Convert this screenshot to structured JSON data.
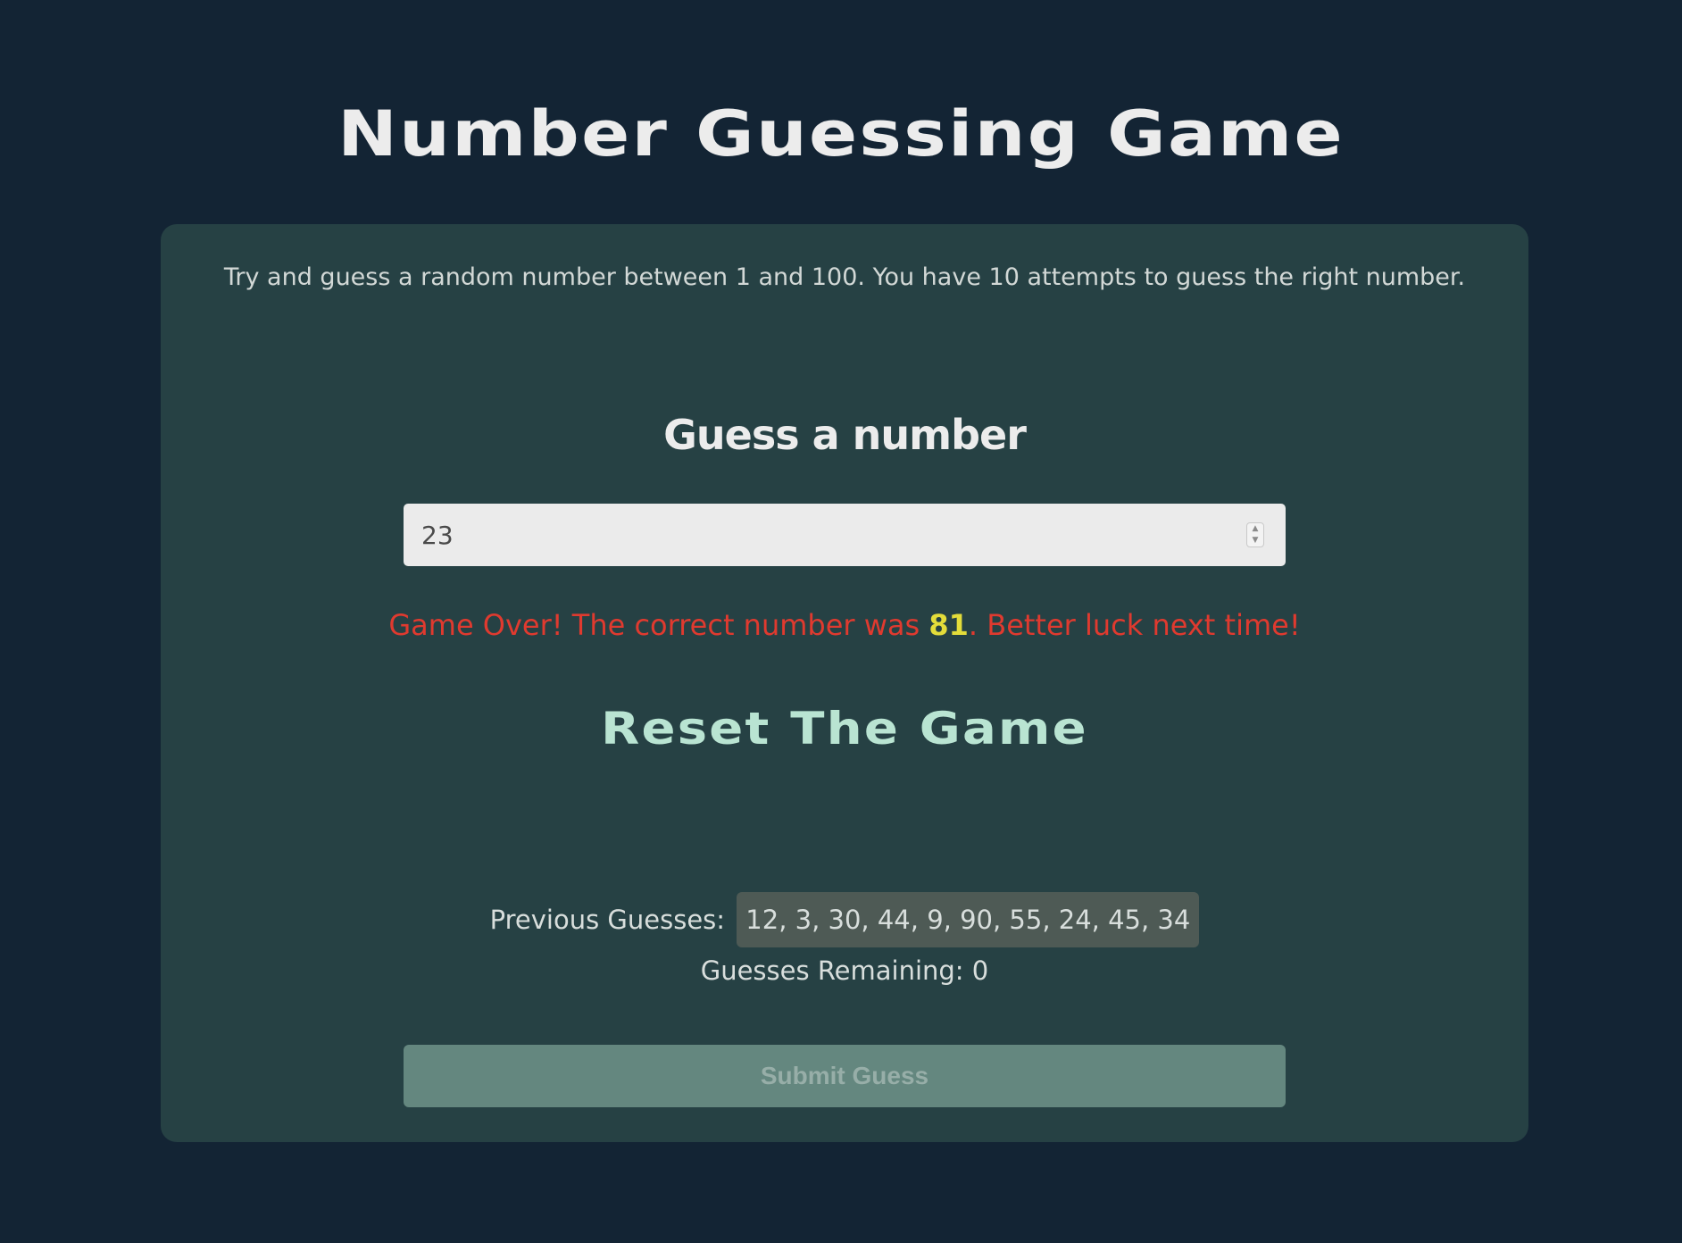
{
  "header": {
    "title": "Number Guessing Game"
  },
  "game": {
    "intro": "Try and guess a random number between 1 and 100. You have 10 attempts to guess the right number.",
    "guess_heading": "Guess a number",
    "input_value": "23",
    "result": {
      "prefix": "Game Over! The correct number was ",
      "correct_number": "81",
      "suffix": ". Better luck next time!"
    },
    "reset_label": "Reset The Game",
    "previous_guesses_label": "Previous Guesses:",
    "previous_guesses": "12, 3, 30, 44, 9, 90, 55, 24, 45, 34",
    "remaining_label": "Guesses Remaining: 0",
    "submit_label": "Submit Guess"
  },
  "colors": {
    "background": "#132434",
    "card": "#264144",
    "error_text": "#e03a2f",
    "highlight_number": "#e3dc3a",
    "reset_text": "#b9e4d2",
    "submit_disabled": "#64877f"
  },
  "icons": {
    "spinner_up": "chevron-up-icon",
    "spinner_down": "chevron-down-icon"
  }
}
